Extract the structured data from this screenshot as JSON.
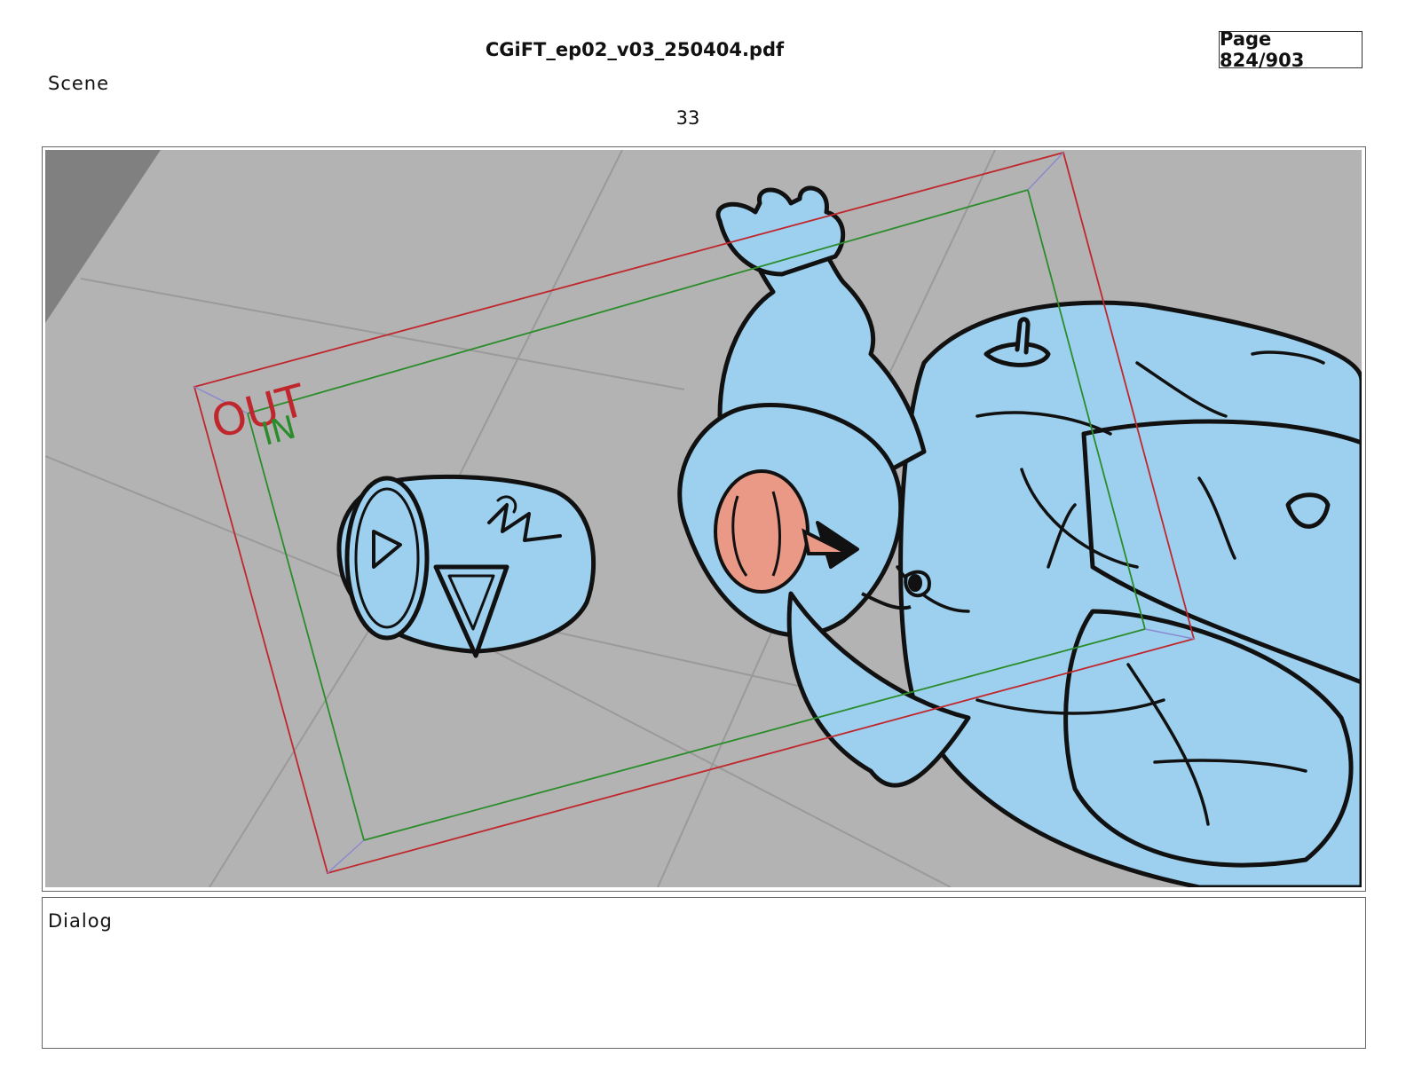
{
  "header": {
    "document_title": "CGiFT_ep02_v03_250404.pdf",
    "page_indicator": "Page 824/903"
  },
  "scene": {
    "label": "Scene",
    "number": "33"
  },
  "panel": {
    "safe_area": {
      "outer_label": "OUT",
      "inner_label": "IN",
      "outer_color": "#c0272d",
      "inner_color": "#2a8c2a"
    },
    "colors": {
      "floor": "#b3b3b3",
      "character": "#9dd0ef",
      "nose": "#e99985",
      "line": "#111111"
    }
  },
  "dialog": {
    "label": "Dialog"
  }
}
